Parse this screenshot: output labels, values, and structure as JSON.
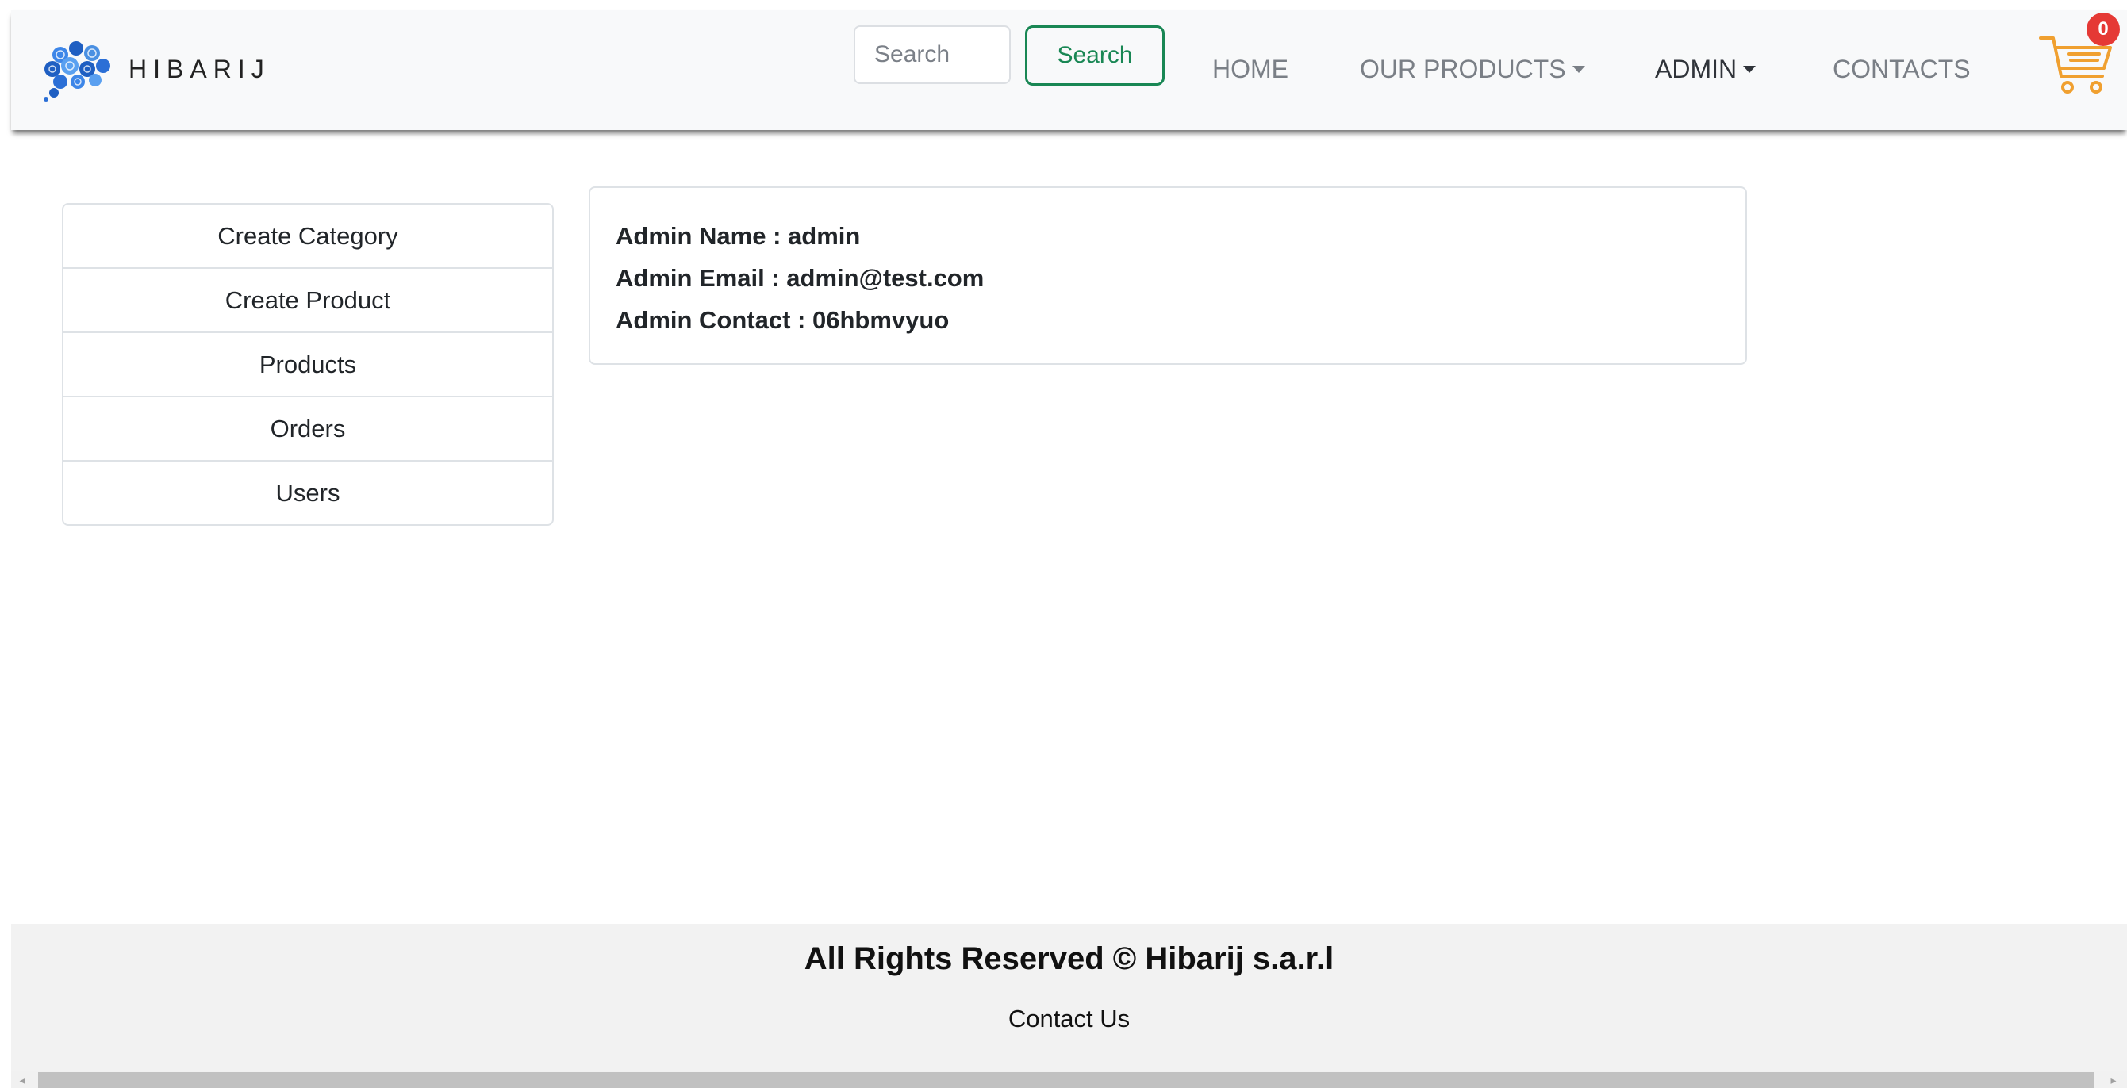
{
  "navbar": {
    "brand": "HIBARIJ",
    "search_placeholder": "Search",
    "search_button": "Search",
    "links": {
      "home": "HOME",
      "products": "OUR PRODUCTS",
      "admin": "ADMIN",
      "contacts": "CONTACTS"
    },
    "cart_count": "0",
    "icons": {
      "logo": "brain-logo-icon",
      "cart": "shopping-cart-icon"
    }
  },
  "sidebar": {
    "items": [
      {
        "label": "Create Category"
      },
      {
        "label": "Create Product"
      },
      {
        "label": "Products"
      },
      {
        "label": "Orders"
      },
      {
        "label": "Users"
      }
    ]
  },
  "admin_info": {
    "name": "Admin Name : admin",
    "email": "Admin Email : admin@test.com",
    "contact": "Admin Contact : 06hbmvyuo"
  },
  "footer": {
    "copyright": "All Rights Reserved © Hibarij s.a.r.l",
    "contact_link": "Contact Us"
  },
  "colors": {
    "accent_green": "#198754",
    "cart_orange": "#f0a030",
    "badge_red": "#e53935",
    "logo_blue": "#2b6fd6"
  }
}
